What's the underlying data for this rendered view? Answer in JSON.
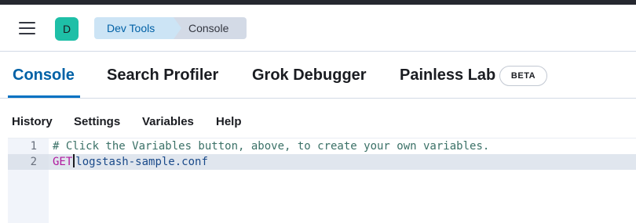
{
  "header": {
    "avatar_letter": "D",
    "breadcrumbs": [
      {
        "label": "Dev Tools"
      },
      {
        "label": "Console"
      }
    ]
  },
  "tabs": [
    {
      "label": "Console",
      "active": true
    },
    {
      "label": "Search Profiler",
      "active": false
    },
    {
      "label": "Grok Debugger",
      "active": false
    },
    {
      "label": "Painless Lab",
      "active": false,
      "badge": "BETA"
    }
  ],
  "toolbar": {
    "items": [
      "History",
      "Settings",
      "Variables",
      "Help"
    ]
  },
  "editor": {
    "lines": [
      {
        "number": "1",
        "comment": "# Click the Variables button, above, to create your own variables."
      },
      {
        "number": "2",
        "method": "GET",
        "url": "logstash-sample.conf"
      }
    ],
    "active_line": 2
  },
  "colors": {
    "accent": "#0071c2",
    "avatar": "#1ebfa7",
    "top_strip": "#25282f"
  }
}
